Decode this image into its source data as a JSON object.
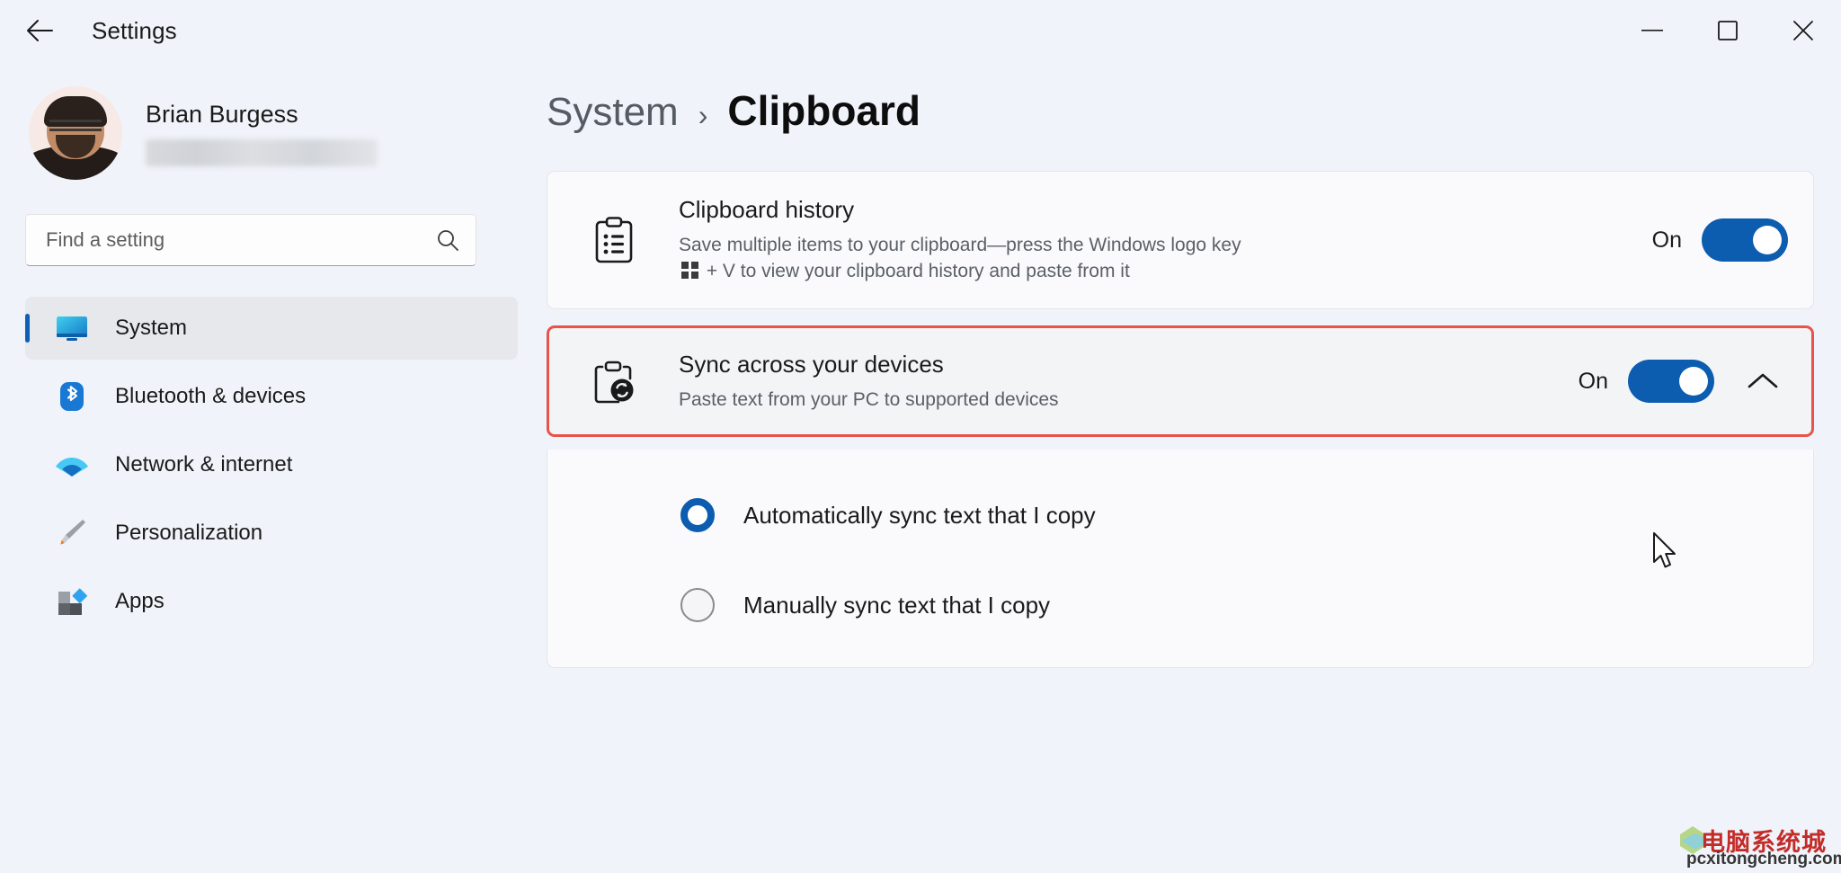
{
  "window": {
    "title": "Settings",
    "back_label": "Back",
    "minimize_label": "Minimize",
    "maximize_label": "Maximize",
    "close_label": "Close"
  },
  "sidebar": {
    "profile": {
      "name": "Brian Burgess",
      "email_redacted": ""
    },
    "search": {
      "placeholder": "Find a setting",
      "value": ""
    },
    "items": [
      {
        "label": "System",
        "icon": "monitor-icon",
        "active": true
      },
      {
        "label": "Bluetooth & devices",
        "icon": "bluetooth-icon",
        "active": false
      },
      {
        "label": "Network & internet",
        "icon": "wifi-icon",
        "active": false
      },
      {
        "label": "Personalization",
        "icon": "paintbrush-icon",
        "active": false
      },
      {
        "label": "Apps",
        "icon": "apps-icon",
        "active": false
      }
    ]
  },
  "main": {
    "breadcrumb": {
      "parent": "System",
      "separator": "›",
      "current": "Clipboard"
    },
    "settings": [
      {
        "id": "clipboard-history",
        "icon": "clipboard-list-icon",
        "title": "Clipboard history",
        "desc_part1": "Save multiple items to your clipboard—press the Windows logo key ",
        "desc_part2": " + V to view your clipboard history and paste from it",
        "toggle_state": "On",
        "toggle_on": true,
        "highlighted": false,
        "expandable": false
      },
      {
        "id": "sync-across-devices",
        "icon": "clipboard-sync-icon",
        "title": "Sync across your devices",
        "desc_part1": "Paste text from your PC to supported devices",
        "desc_part2": "",
        "toggle_state": "On",
        "toggle_on": true,
        "highlighted": true,
        "expandable": true,
        "expanded": true,
        "chevron": "chevron-up-icon"
      }
    ],
    "sync_options": [
      {
        "label": "Automatically sync text that I copy",
        "checked": true
      },
      {
        "label": "Manually sync text that I copy",
        "checked": false
      }
    ]
  },
  "watermark": {
    "cn": "电脑系统城",
    "en": "pcxitongcheng.com"
  },
  "colors": {
    "accent": "#0C5CAF",
    "highlight_border": "#E8534A",
    "sidebar_bg": "#F0F3F9",
    "card_bg": "#FAFAFC",
    "watermark_red": "#C0221E"
  }
}
